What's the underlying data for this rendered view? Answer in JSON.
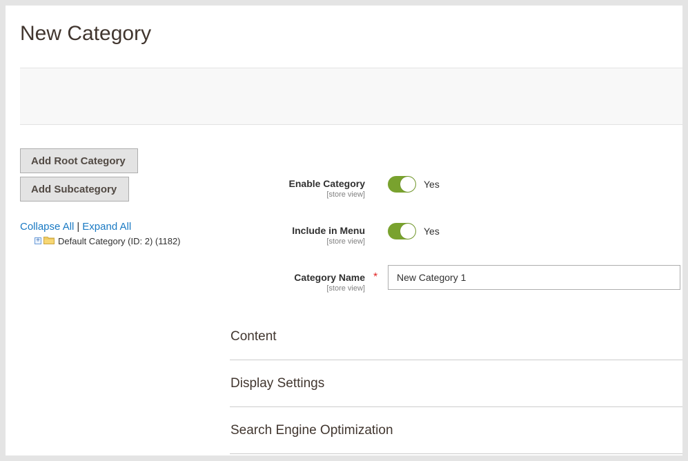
{
  "page": {
    "title": "New Category"
  },
  "actions": {
    "add_root_label": "Add Root Category",
    "add_sub_label": "Add Subcategory"
  },
  "tree": {
    "collapse_label": "Collapse All",
    "separator": "|",
    "expand_label": "Expand All",
    "nodes": [
      {
        "label": "Default Category (ID: 2) (1182)",
        "icon": "folder-icon",
        "expander": "plus-icon"
      }
    ]
  },
  "form": {
    "enable": {
      "label": "Enable Category",
      "scope": "[store view]",
      "state": "Yes",
      "on": true
    },
    "menu": {
      "label": "Include in Menu",
      "scope": "[store view]",
      "state": "Yes",
      "on": true
    },
    "name": {
      "label": "Category Name",
      "scope": "[store view]",
      "required_mark": "*",
      "value": "New Category 1"
    }
  },
  "sections": [
    {
      "title": "Content"
    },
    {
      "title": "Display Settings"
    },
    {
      "title": "Search Engine Optimization"
    }
  ],
  "colors": {
    "toggle_on": "#79a22e",
    "link": "#1979c3",
    "required": "#e22626"
  }
}
